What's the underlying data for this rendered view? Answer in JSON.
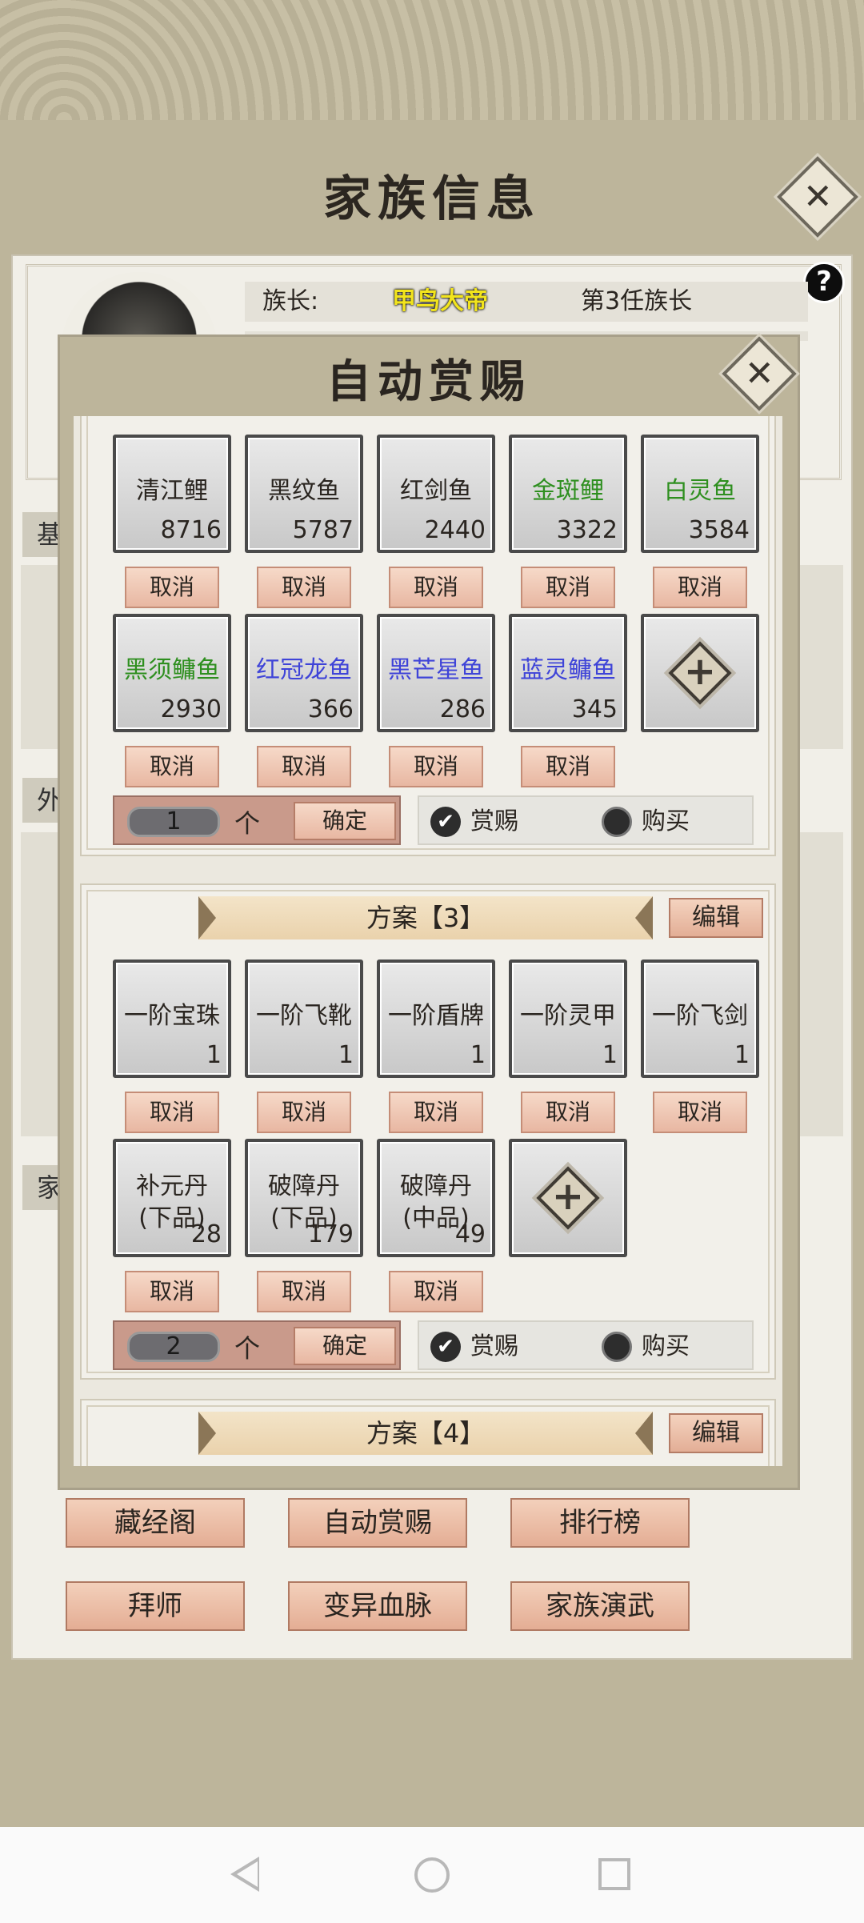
{
  "header": {
    "title": "家族信息"
  },
  "info": {
    "leader_label": "族长:",
    "leader_name": "甲鸟大帝",
    "leader_rank": "第3任族长",
    "side_tabs": [
      "基",
      "外",
      "家"
    ]
  },
  "dialog": {
    "title": "自动赏赐",
    "plans": [
      {
        "items": [
          {
            "name": "清江鲤",
            "count": "8716",
            "color": "black"
          },
          {
            "name": "黑纹鱼",
            "count": "5787",
            "color": "black"
          },
          {
            "name": "红剑鱼",
            "count": "2440",
            "color": "black"
          },
          {
            "name": "金斑鲤",
            "count": "3322",
            "color": "green"
          },
          {
            "name": "白灵鱼",
            "count": "3584",
            "color": "green"
          },
          {
            "name": "黑须鳙鱼",
            "count": "2930",
            "color": "green"
          },
          {
            "name": "红冠龙鱼",
            "count": "366",
            "color": "blue"
          },
          {
            "name": "黑芒星鱼",
            "count": "286",
            "color": "blue"
          },
          {
            "name": "蓝灵鳙鱼",
            "count": "345",
            "color": "blue"
          }
        ],
        "quantity": "1",
        "reward_selected": true
      },
      {
        "label": "方案【3】",
        "items": [
          {
            "name": "一阶宝珠",
            "count": "1"
          },
          {
            "name": "一阶飞靴",
            "count": "1"
          },
          {
            "name": "一阶盾牌",
            "count": "1"
          },
          {
            "name": "一阶灵甲",
            "count": "1"
          },
          {
            "name": "一阶飞剑",
            "count": "1"
          },
          {
            "name": "补元丹",
            "name2": "(下品)",
            "count": "28"
          },
          {
            "name": "破障丹",
            "name2": "(下品)",
            "count": "179"
          },
          {
            "name": "破障丹",
            "name2": "(中品)",
            "count": "49"
          }
        ],
        "quantity": "2",
        "reward_selected": true
      },
      {
        "label": "方案【4】"
      }
    ],
    "cancel_label": "取消",
    "unit_label": "个",
    "confirm_label": "确定",
    "reward_label": "赏赐",
    "buy_label": "购买",
    "edit_label": "编辑"
  },
  "bottom_buttons": [
    "藏经阁",
    "自动赏赐",
    "排行榜",
    "拜师",
    "变异血脉",
    "家族演武"
  ],
  "colors": {
    "green": "#2e8f1f",
    "blue": "#3f44d8",
    "background": "#bdb59b",
    "panel": "#f1efe8"
  },
  "navbar": {
    "icons": [
      "back-icon",
      "home-icon",
      "recent-apps-icon"
    ]
  }
}
